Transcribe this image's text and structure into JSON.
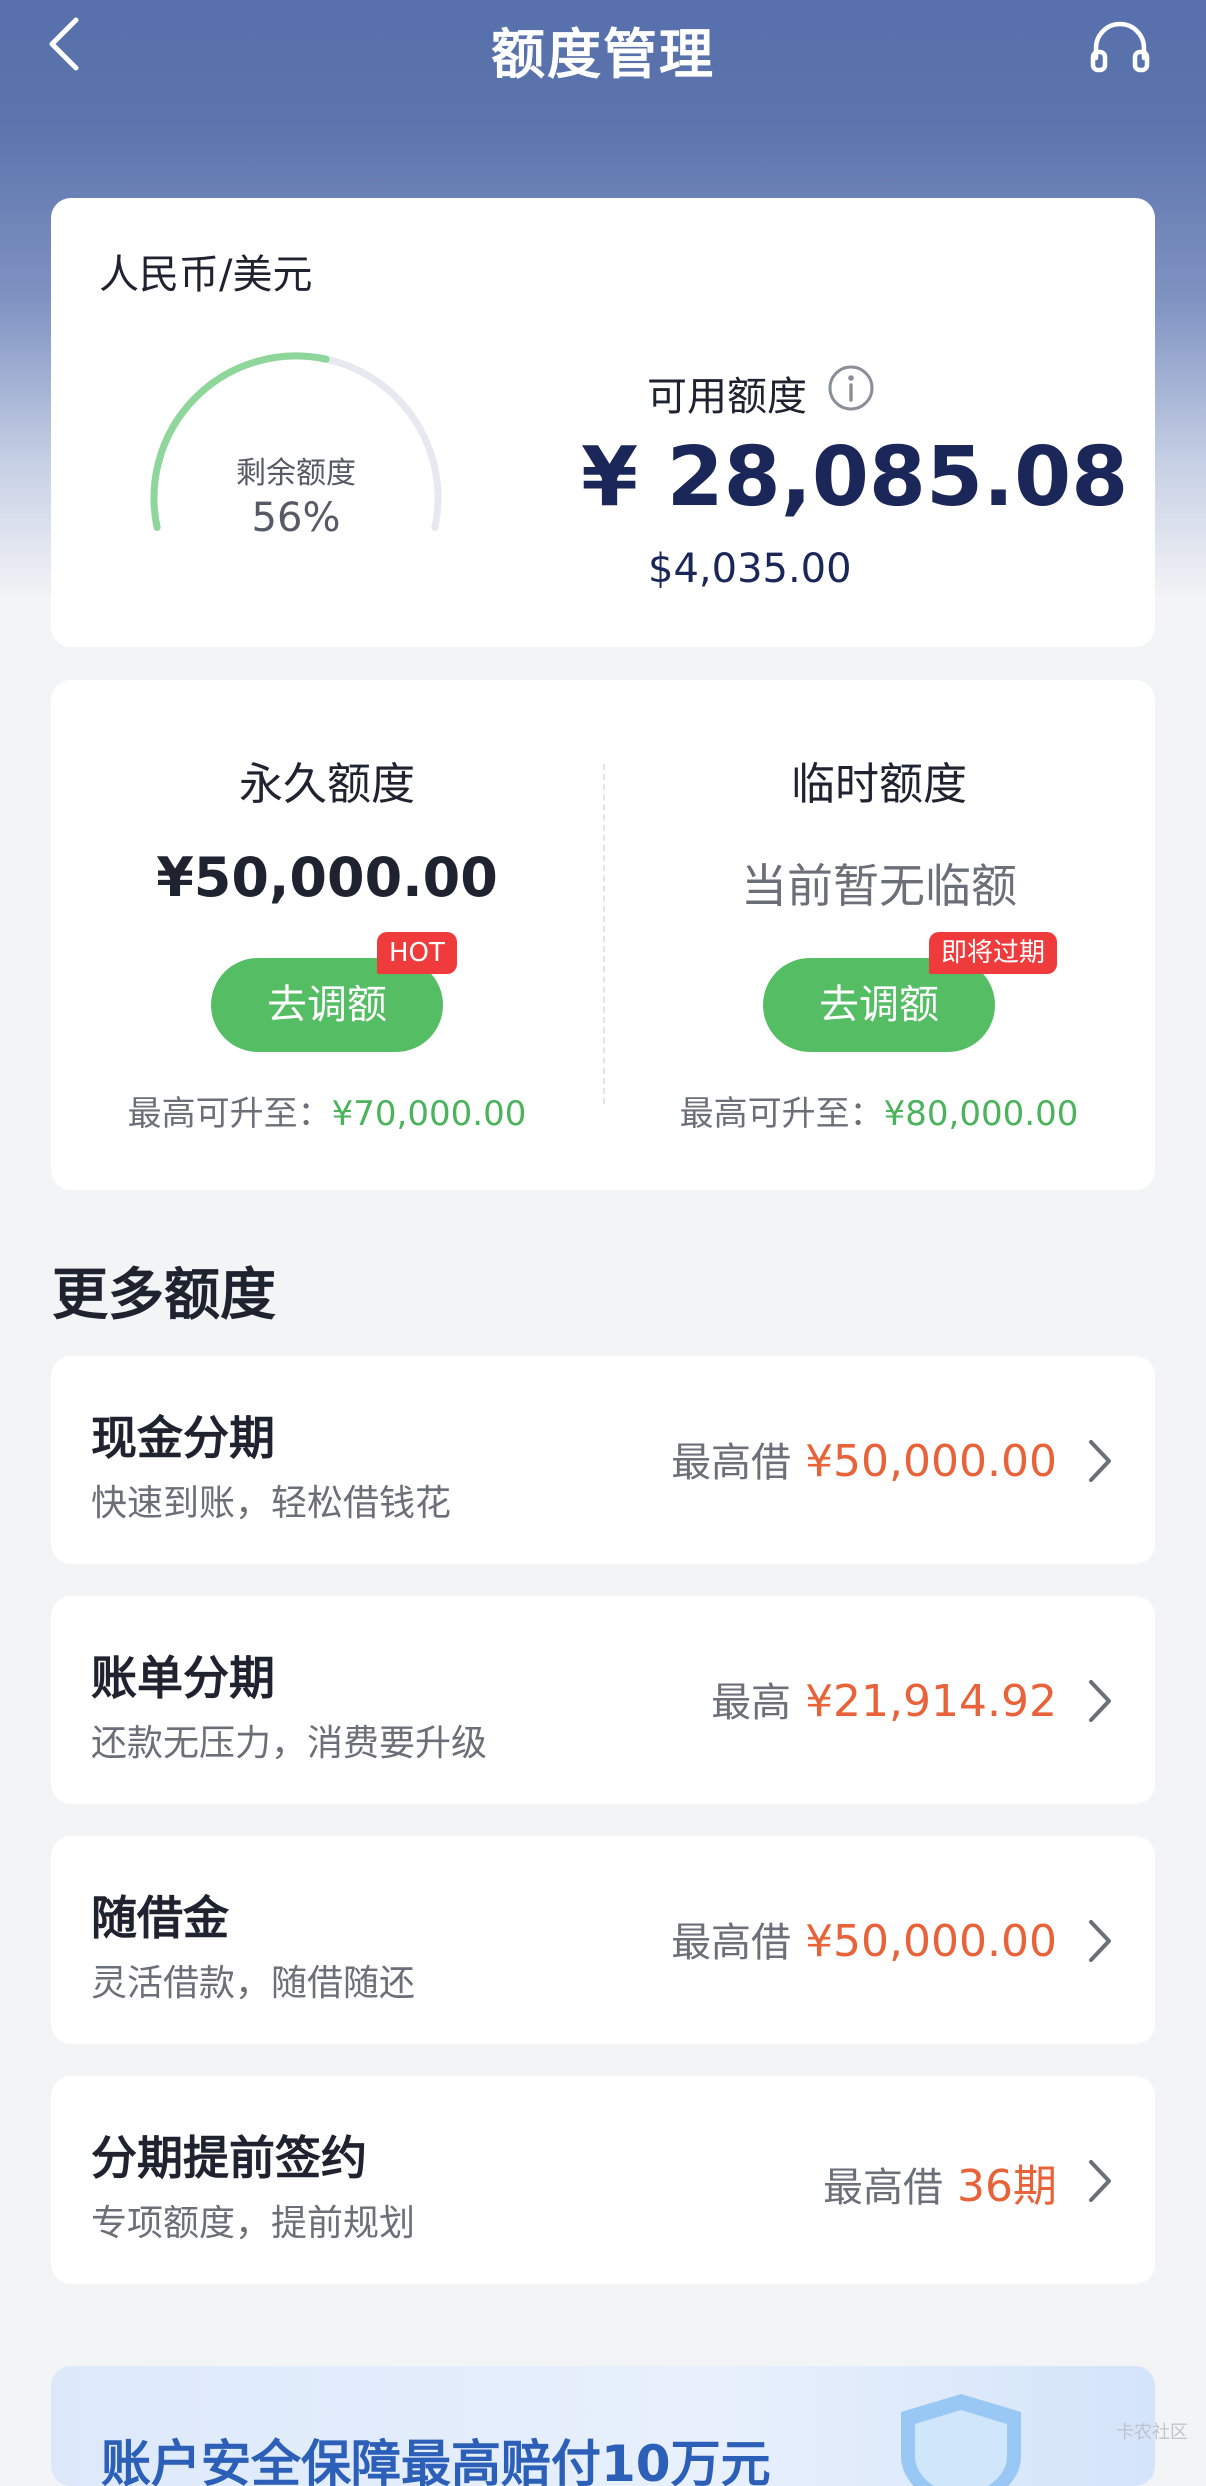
{
  "header": {
    "title": "额度管理"
  },
  "summary": {
    "currency_label": "人民币/美元",
    "gauge_label": "剩余额度",
    "gauge_percent_text": "56%",
    "remaining_fraction": 0.56,
    "available_label": "可用额度",
    "cny_amount": "¥ 28,085.08",
    "usd_amount": "$4,035.00"
  },
  "limits": {
    "permanent": {
      "title": "永久额度",
      "value": "¥50,000.00",
      "button_label": "去调额",
      "badge": "HOT",
      "max_label": "最高可升至：",
      "max_value": "¥70,000.00"
    },
    "temporary": {
      "title": "临时额度",
      "value": "当前暂无临额",
      "button_label": "去调额",
      "badge": "即将过期",
      "max_label": "最高可升至：",
      "max_value": "¥80,000.00"
    }
  },
  "more": {
    "title": "更多额度",
    "items": [
      {
        "title": "现金分期",
        "subtitle": "快速到账，轻松借钱花",
        "prefix": "最高借",
        "amount": "¥50,000.00"
      },
      {
        "title": "账单分期",
        "subtitle": "还款无压力，消费要升级",
        "prefix": "最高",
        "amount": "¥21,914.92"
      },
      {
        "title": "随借金",
        "subtitle": "灵活借款，随借随还",
        "prefix": "最高借",
        "amount": "¥50,000.00"
      },
      {
        "title": "分期提前签约",
        "subtitle": "专项额度，提前规划",
        "prefix": "最高借",
        "amount": "36期"
      }
    ]
  },
  "banner": {
    "text": "账户安全保障最高赔付10万元"
  },
  "watermark": "卡农社区",
  "colors": {
    "header_bg": "#5770ac",
    "accent_green": "#55bd63",
    "badge_red": "#ef3b3b",
    "amount_orange": "#e8623a",
    "amount_navy": "#1b2758"
  },
  "icons": {
    "back": "chevron-left-icon",
    "support": "headset-icon",
    "info": "info-icon",
    "row_arrow": "chevron-right-icon"
  }
}
